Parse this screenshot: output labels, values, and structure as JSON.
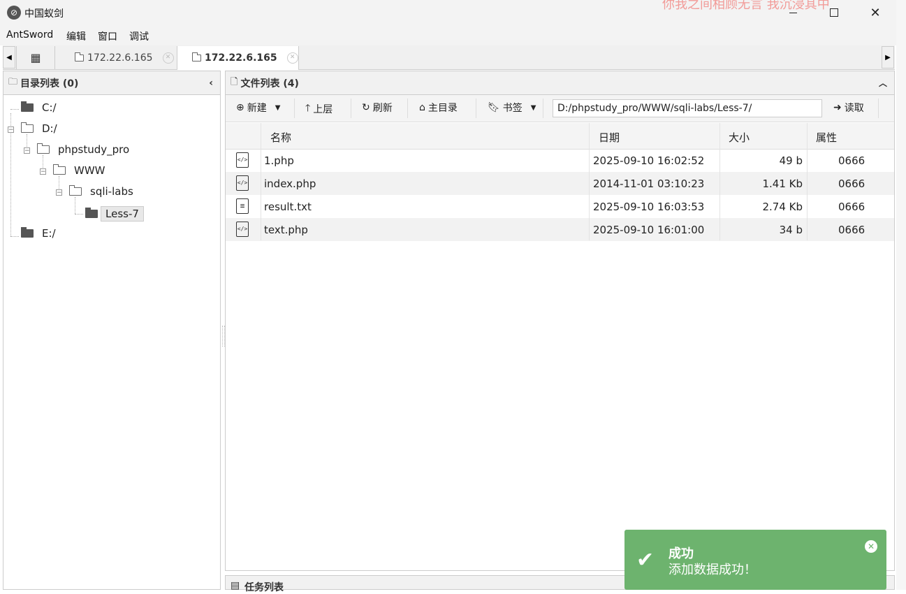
{
  "window": {
    "title": "中国蚁剑",
    "marquee": "你我之间相顾无言 我沉浸其中"
  },
  "menu": [
    "AntSword",
    "编辑",
    "窗口",
    "调试"
  ],
  "tabs": [
    {
      "label": "172.22.6.165",
      "active": false
    },
    {
      "label": "172.22.6.165",
      "active": true
    }
  ],
  "dir_panel": {
    "title": "目录列表 (0)",
    "tree": [
      {
        "label": "C:/",
        "level": 0
      },
      {
        "label": "D:/",
        "level": 0
      },
      {
        "label": "phpstudy_pro",
        "level": 1
      },
      {
        "label": "WWW",
        "level": 2
      },
      {
        "label": "sqli-labs",
        "level": 3
      },
      {
        "label": "Less-7",
        "level": 4,
        "selected": true
      },
      {
        "label": "E:/",
        "level": 0
      }
    ]
  },
  "file_panel": {
    "title": "文件列表 (4)",
    "toolbar": {
      "new": "新建",
      "up": "上层",
      "refresh": "刷新",
      "home": "主目录",
      "bookmark": "书签",
      "path": "D:/phpstudy_pro/WWW/sqli-labs/Less-7/",
      "read": "读取"
    },
    "columns": [
      "名称",
      "日期",
      "大小",
      "属性"
    ],
    "files": [
      {
        "name": "1.php",
        "date": "2025-09-10 16:02:52",
        "size": "49 b",
        "attr": "0666",
        "icon": "code-file-icon"
      },
      {
        "name": "index.php",
        "date": "2014-11-01 03:10:23",
        "size": "1.41 Kb",
        "attr": "0666",
        "icon": "code-file-icon"
      },
      {
        "name": "result.txt",
        "date": "2025-09-10 16:03:53",
        "size": "2.74 Kb",
        "attr": "0666",
        "icon": "text-file-icon"
      },
      {
        "name": "text.php",
        "date": "2025-09-10 16:01:00",
        "size": "34 b",
        "attr": "0666",
        "icon": "code-file-icon"
      }
    ]
  },
  "task_panel": {
    "title": "任务列表"
  },
  "toast": {
    "title": "成功",
    "message": "添加数据成功！",
    "color": "#6db36e"
  }
}
